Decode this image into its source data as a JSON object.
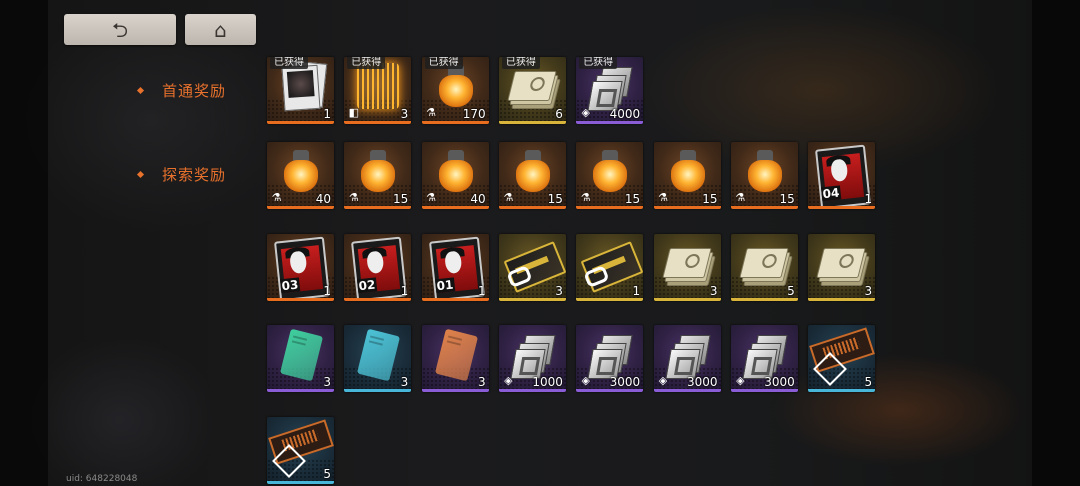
{
  "nav": {
    "back_icon": "return-arrow-icon",
    "back_glyph": "⮌",
    "home_icon": "home-icon",
    "home_glyph": "⌂"
  },
  "sections": {
    "first_clear": "首通奖励",
    "exploration": "探索奖励"
  },
  "obtained_label": "已获得",
  "uid": "uid: 648228048",
  "first_clear_items": [
    {
      "icon": "photo-stack-icon",
      "rarity": "orange",
      "qty": "1",
      "obtained": true
    },
    {
      "icon": "glowing-cube-icon",
      "rarity": "orange",
      "qty": "3",
      "obtained": true
    },
    {
      "icon": "orange-flask-icon",
      "rarity": "orange",
      "qty": "170",
      "obtained": true
    },
    {
      "icon": "document-stack-icon",
      "rarity": "gold",
      "qty": "6",
      "obtained": true
    },
    {
      "icon": "silver-block-icon",
      "rarity": "purple",
      "qty": "4000",
      "obtained": true
    }
  ],
  "exploration_rows": [
    [
      {
        "icon": "orange-flask-icon",
        "rarity": "orange",
        "qty": "40"
      },
      {
        "icon": "orange-flask-icon",
        "rarity": "orange",
        "qty": "15"
      },
      {
        "icon": "orange-flask-icon",
        "rarity": "orange",
        "qty": "40"
      },
      {
        "icon": "orange-flask-icon",
        "rarity": "orange",
        "qty": "15"
      },
      {
        "icon": "orange-flask-icon",
        "rarity": "orange",
        "qty": "15"
      },
      {
        "icon": "orange-flask-icon",
        "rarity": "orange",
        "qty": "15"
      },
      {
        "icon": "orange-flask-icon",
        "rarity": "orange",
        "qty": "15"
      },
      {
        "icon": "joker-card-icon",
        "rarity": "orange",
        "qty": "1",
        "card_no": "04"
      }
    ],
    [
      {
        "icon": "joker-card-icon",
        "rarity": "orange",
        "qty": "1",
        "card_no": "03"
      },
      {
        "icon": "joker-card-icon",
        "rarity": "orange",
        "qty": "1",
        "card_no": "02"
      },
      {
        "icon": "joker-card-icon",
        "rarity": "orange",
        "qty": "1",
        "card_no": "01"
      },
      {
        "icon": "gold-ticket-icon",
        "rarity": "gold",
        "qty": "3"
      },
      {
        "icon": "gold-ticket-icon",
        "rarity": "gold",
        "qty": "1"
      },
      {
        "icon": "document-stack-icon",
        "rarity": "gold",
        "qty": "3"
      },
      {
        "icon": "document-stack-icon",
        "rarity": "gold",
        "qty": "5"
      },
      {
        "icon": "document-stack-icon",
        "rarity": "gold",
        "qty": "3"
      }
    ],
    [
      {
        "icon": "green-notebook-icon",
        "rarity": "purple",
        "qty": "3",
        "color": "#3fcf9e"
      },
      {
        "icon": "blue-notebook-icon",
        "rarity": "blue",
        "qty": "3",
        "color": "#4cc3d6"
      },
      {
        "icon": "orange-notebook-icon",
        "rarity": "purple",
        "qty": "3",
        "color": "#e0824a"
      },
      {
        "icon": "silver-block-icon",
        "rarity": "purple",
        "qty": "1000"
      },
      {
        "icon": "silver-block-icon",
        "rarity": "purple",
        "qty": "3000"
      },
      {
        "icon": "silver-block-icon",
        "rarity": "purple",
        "qty": "3000"
      },
      {
        "icon": "silver-block-icon",
        "rarity": "purple",
        "qty": "3000"
      },
      {
        "icon": "circuit-chip-icon",
        "rarity": "blue",
        "qty": "5"
      }
    ],
    [
      {
        "icon": "circuit-chip-icon",
        "rarity": "blue",
        "qty": "5"
      }
    ]
  ]
}
